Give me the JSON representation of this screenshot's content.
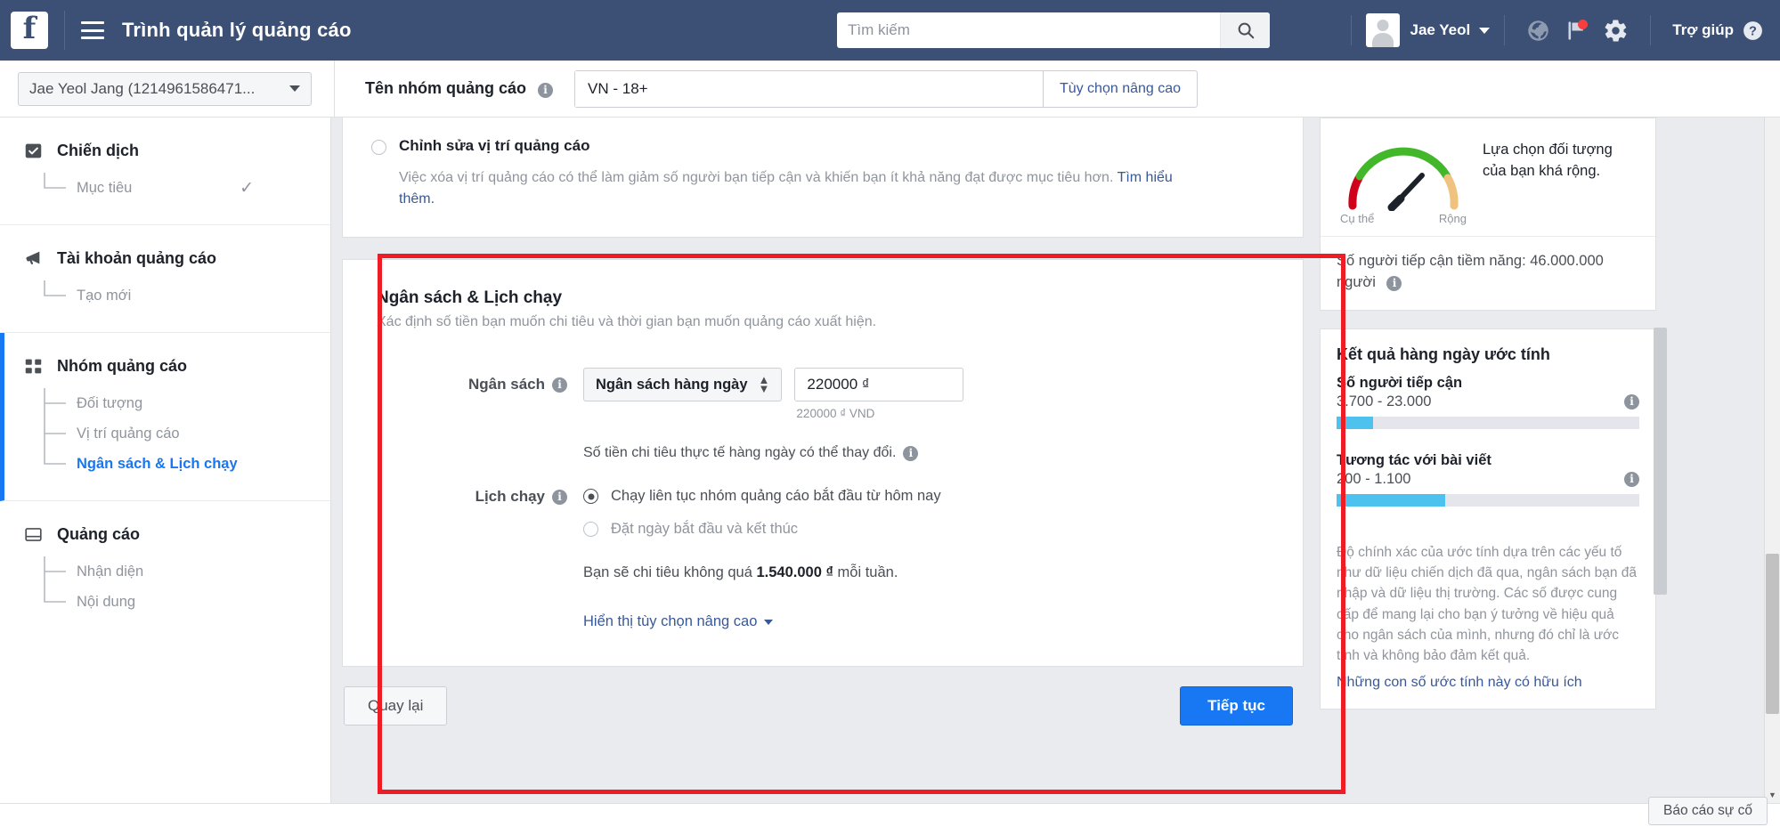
{
  "topbar": {
    "logo": "f",
    "title": "Trình quản lý quảng cáo",
    "search_placeholder": "Tìm kiếm",
    "user_name": "Jae Yeol",
    "help_label": "Trợ giúp",
    "icons": [
      "menu-icon",
      "search-icon",
      "globe-icon",
      "flag-icon",
      "gear-icon",
      "question-icon"
    ]
  },
  "secondbar": {
    "account": "Jae Yeol Jang (1214961586471...",
    "adset_name_label": "Tên nhóm quảng cáo",
    "adset_name_value": "VN - 18+",
    "advanced_options": "Tùy chọn nâng cao"
  },
  "sidebar": {
    "groups": [
      {
        "label": "Chiến dịch",
        "icon": "checkbox-icon",
        "active": false,
        "items": [
          {
            "label": "Mục tiêu",
            "current": false,
            "done": true
          }
        ]
      },
      {
        "label": "Tài khoản quảng cáo",
        "icon": "megaphone-icon",
        "active": false,
        "items": [
          {
            "label": "Tạo mới",
            "current": false,
            "done": false
          }
        ]
      },
      {
        "label": "Nhóm quảng cáo",
        "icon": "grid-icon",
        "active": true,
        "items": [
          {
            "label": "Đối tượng",
            "current": false,
            "done": false
          },
          {
            "label": "Vị trí quảng cáo",
            "current": false,
            "done": false
          },
          {
            "label": "Ngân sách & Lịch chạy",
            "current": true,
            "done": false
          }
        ]
      },
      {
        "label": "Quảng cáo",
        "icon": "window-icon",
        "active": false,
        "items": [
          {
            "label": "Nhận diện",
            "current": false,
            "done": false
          },
          {
            "label": "Nội dung",
            "current": false,
            "done": false
          }
        ]
      }
    ]
  },
  "placement": {
    "radio_label": "Chỉnh sửa vị trí quảng cáo",
    "description": "Việc xóa vị trí quảng cáo có thể làm giảm số người bạn tiếp cận và khiến bạn ít khả năng đạt được mục tiêu hơn.",
    "learn_more": "Tìm hiểu thêm."
  },
  "budget": {
    "title": "Ngân sách & Lịch chạy",
    "subtitle": "Xác định số tiền bạn muốn chi tiêu và thời gian bạn muốn quảng cáo xuất hiện.",
    "budget_label": "Ngân sách",
    "budget_type": "Ngân sách hàng ngày",
    "amount_value": "220000 ₫",
    "amount_help": "220000 ₫ VND",
    "spend_note": "Số tiền chi tiêu thực tế hàng ngày có thể thay đổi.",
    "schedule_label": "Lịch chạy",
    "schedule_options": [
      {
        "label": "Chạy liên tục nhóm quảng cáo bắt đầu từ hôm nay",
        "selected": true
      },
      {
        "label": "Đặt ngày bắt đầu và kết thúc",
        "selected": false
      }
    ],
    "spend_cap_prefix": "Bạn sẽ chi tiêu không quá ",
    "spend_cap_amount": "1.540.000 ₫",
    "spend_cap_suffix": " mỗi tuần.",
    "advanced_toggle": "Hiển thị tùy chọn nâng cao",
    "back_button": "Quay lại",
    "next_button": "Tiếp tục"
  },
  "estimate": {
    "gauge_low_label": "Cụ thể",
    "gauge_high_label": "Rộng",
    "gauge_message": "Lựa chọn đối tượng của bạn khá rộng.",
    "potential_reach": "Số người tiếp cận tiềm năng: 46.000.000 người",
    "results_title": "Kết quả hàng ngày ước tính",
    "metrics": [
      {
        "name": "Số người tiếp cận",
        "range": "3.700 - 23.000",
        "bar_percent": 12
      },
      {
        "name": "Tương tác với bài viết",
        "range": "200 - 1.100",
        "bar_percent": 36
      }
    ],
    "disclaimer": "Độ chính xác của ước tính dựa trên các yếu tố như dữ liệu chiến dịch đã qua, ngân sách bạn đã nhập và dữ liệu thị trường. Các số được cung cấp để mang lại cho bạn ý tưởng về hiệu quả cho ngân sách của mình, nhưng đó chỉ là ước tính và không bảo đảm kết quả.",
    "useful_link": "Những con số ước tính này có hữu ích"
  },
  "footer": {
    "report_button": "Báo cáo sự cố"
  },
  "colors": {
    "brand_blue": "#1877f2",
    "header_blue": "#3b5074",
    "link_blue": "#385898",
    "annotation_red": "#ee1c25",
    "gauge_green": "#42b72a",
    "gauge_red": "#d0021b",
    "gauge_orange": "#f0c27f",
    "bar_cyan": "#4ec2ef"
  }
}
